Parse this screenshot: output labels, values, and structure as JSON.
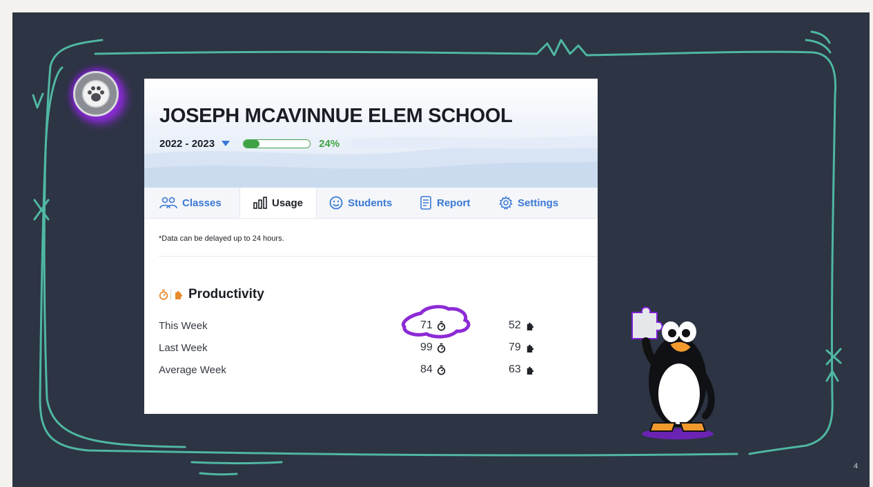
{
  "school": {
    "name": "JOSEPH MCAVINNUE ELEM SCHOOL",
    "year": "2022 - 2023",
    "progress_percent": 24,
    "progress_label": "24%"
  },
  "tabs": [
    {
      "label": "Classes",
      "icon": "people-icon",
      "active": false
    },
    {
      "label": "Usage",
      "icon": "bar-chart-icon",
      "active": true
    },
    {
      "label": "Students",
      "icon": "smiley-icon",
      "active": false
    },
    {
      "label": "Report",
      "icon": "report-icon",
      "active": false
    },
    {
      "label": "Settings",
      "icon": "gear-icon",
      "active": false
    }
  ],
  "note": "*Data can be delayed up to 24 hours.",
  "productivity": {
    "title": "Productivity",
    "rows": [
      {
        "label": "This Week",
        "minutes": "71",
        "puzzles": "52"
      },
      {
        "label": "Last Week",
        "minutes": "99",
        "puzzles": "79"
      },
      {
        "label": "Average Week",
        "minutes": "84",
        "puzzles": "63"
      }
    ]
  },
  "colors": {
    "slide_bg": "#2d3443",
    "frame": "#4fb7a3",
    "accent_blue": "#3a78d4",
    "progress_green": "#3fa245",
    "highlight_purple": "#8c2bd6",
    "icon_orange": "#e8892b"
  },
  "slide_number": "4"
}
